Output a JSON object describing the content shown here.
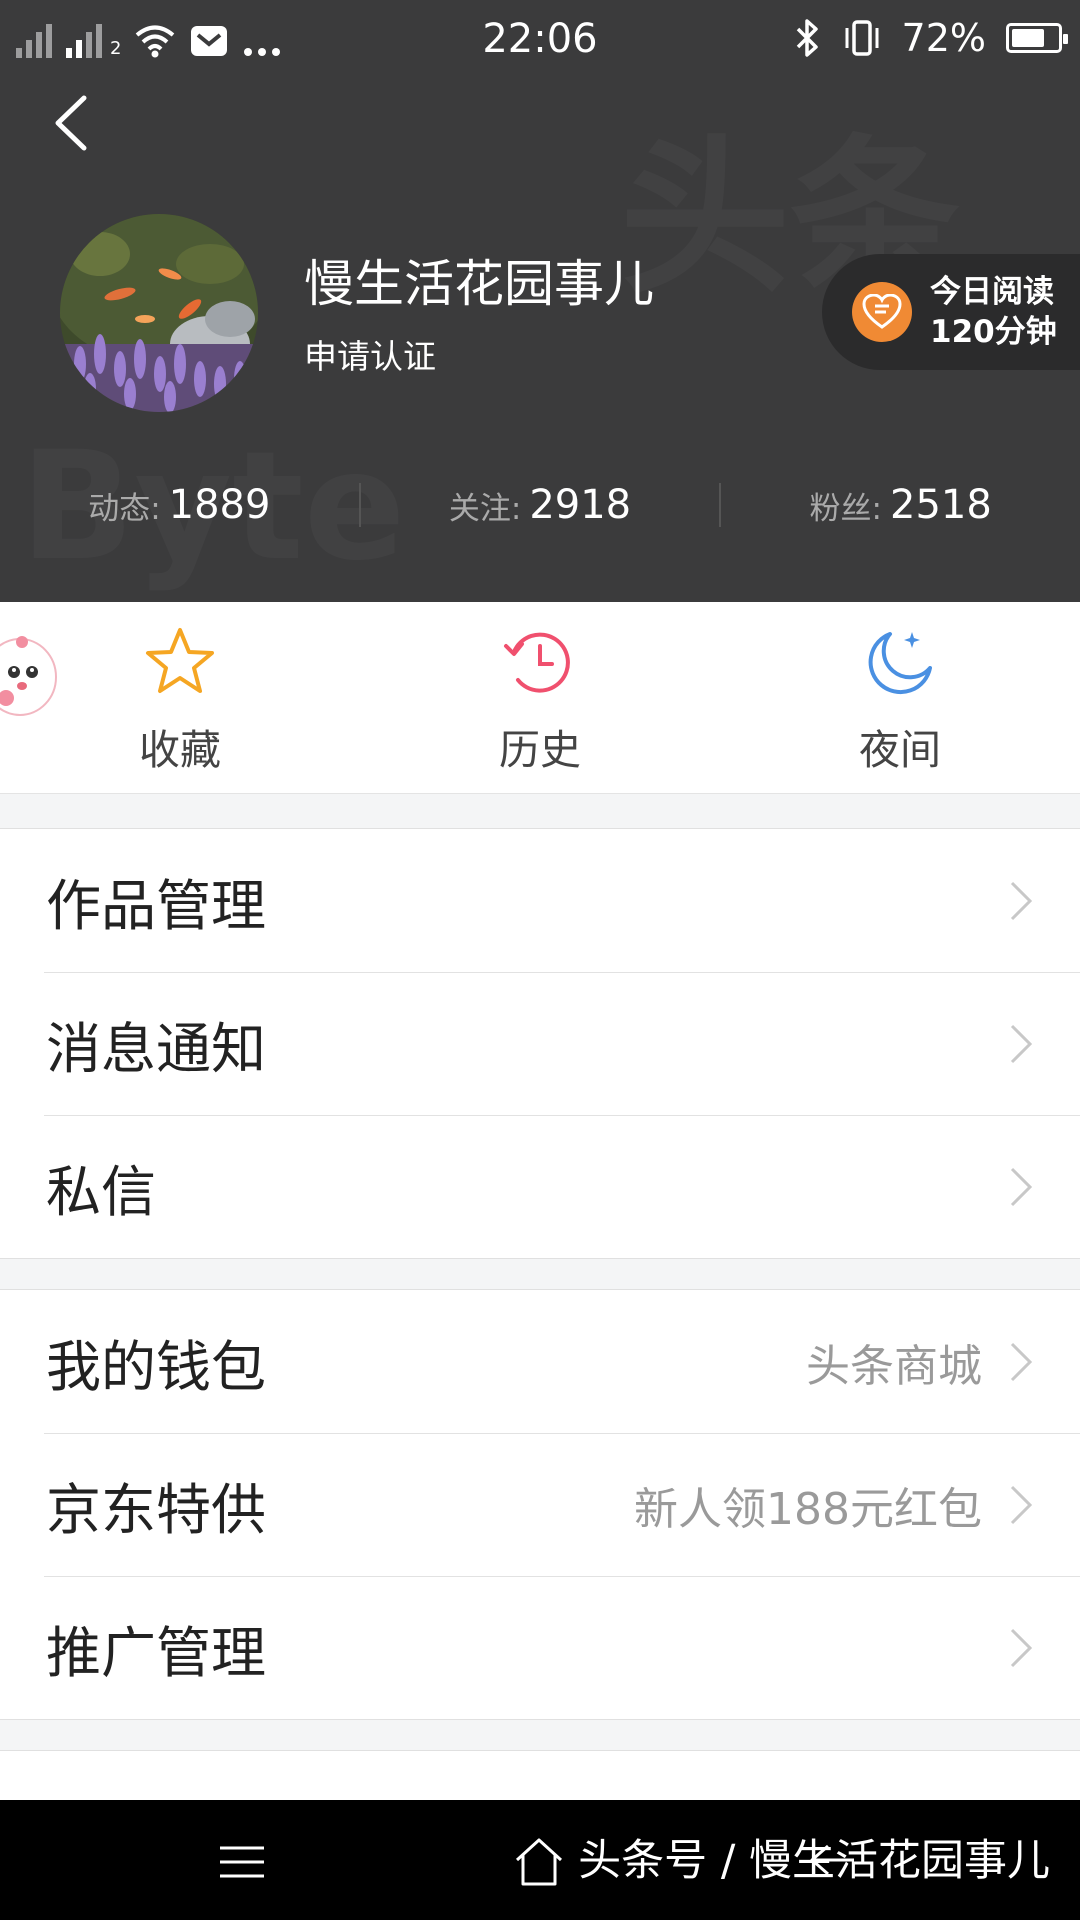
{
  "status_bar": {
    "time": "22:06",
    "battery": "72%",
    "battery_level": 0.72,
    "sim_index": "2"
  },
  "profile": {
    "name": "慢生活花园事儿",
    "verify_label": "申请认证",
    "reading_line1": "今日阅读",
    "reading_line2": "120分钟",
    "stats": [
      {
        "label": "动态:",
        "value": "1889"
      },
      {
        "label": "关注:",
        "value": "2918"
      },
      {
        "label": "粉丝:",
        "value": "2518"
      }
    ]
  },
  "quick_actions": [
    {
      "label": "收藏",
      "icon": "star-icon",
      "color": "#f5a623"
    },
    {
      "label": "历史",
      "icon": "history-clock-icon",
      "color": "#f0506e"
    },
    {
      "label": "夜间",
      "icon": "moon-icon",
      "color": "#4a90e2"
    }
  ],
  "menu_group1": [
    {
      "label": "作品管理",
      "value": ""
    },
    {
      "label": "消息通知",
      "value": ""
    },
    {
      "label": "私信",
      "value": ""
    }
  ],
  "menu_group2": [
    {
      "label": "我的钱包",
      "value": "头条商城"
    },
    {
      "label": "京东特供",
      "value": "新人领188元红包"
    },
    {
      "label": "推广管理",
      "value": ""
    }
  ],
  "watermark": "头条号 / 慢生活花园事儿",
  "colors": {
    "header_bg": "#3b3b3c",
    "reading_accent": "#f08a34"
  }
}
